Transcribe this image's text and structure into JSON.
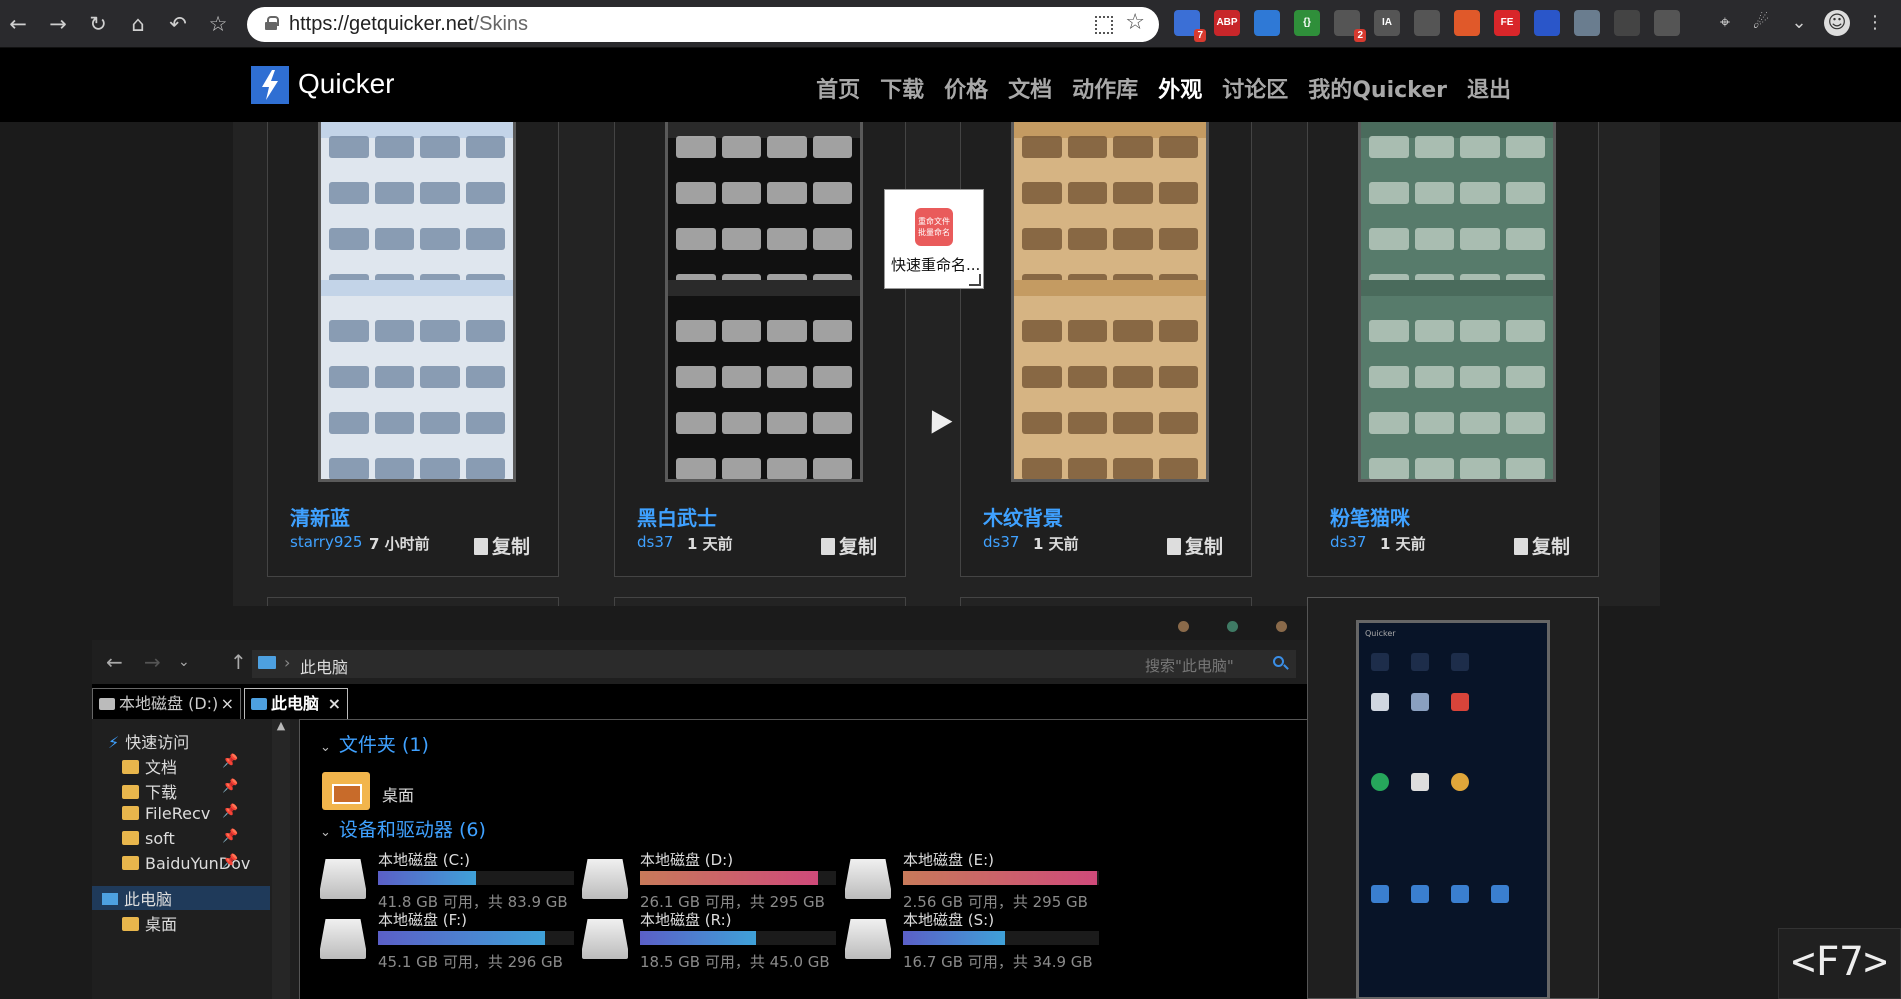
{
  "browser": {
    "url_host": "https://getquicker.net",
    "url_path": "/Skins",
    "extensions": [
      {
        "name": "grid-extension-icon",
        "badge": "7",
        "color": "#3b6fd6"
      },
      {
        "name": "adblock-icon",
        "label": "ABP",
        "color": "#c8262a"
      },
      {
        "name": "shield-check-icon",
        "color": "#2f79d6"
      },
      {
        "name": "json-bracket-icon",
        "label": "{}",
        "color": "#2f8f3a"
      },
      {
        "name": "image-extension-icon",
        "badge": "2",
        "color": "#555555"
      },
      {
        "name": "ia-icon",
        "label": "IA",
        "color": "#555555"
      },
      {
        "name": "cloud-extension-icon",
        "color": "#555555"
      },
      {
        "name": "notes-extension-icon",
        "color": "#e0592a"
      },
      {
        "name": "fe-extension-icon",
        "label": "FE",
        "color": "#d9262a"
      },
      {
        "name": "diamond-extension-icon",
        "color": "#2a56c9"
      },
      {
        "name": "page-extension-icon",
        "color": "#6a7d8f"
      },
      {
        "name": "screen-extension-icon",
        "color": "#444444"
      },
      {
        "name": "pocket-icon",
        "color": "#555555"
      }
    ]
  },
  "site": {
    "logo_text": "Quicker",
    "nav": [
      "首页",
      "下载",
      "价格",
      "文档",
      "动作库",
      "外观",
      "讨论区",
      "我的Quicker",
      "退出"
    ],
    "active_nav": "外观"
  },
  "skins": [
    {
      "title": "清新蓝",
      "author": "starry925",
      "time": "7 小时前",
      "copy": "复制",
      "bg": "#dfe6ee",
      "bar": "#c3d4e8",
      "cell": "#7a8ea8"
    },
    {
      "title": "黑白武士",
      "author": "ds37",
      "time": "1 天前",
      "copy": "复制",
      "bg": "#111111",
      "bar": "#2a2a2a",
      "cell": "#bbbbbb"
    },
    {
      "title": "木纹背景",
      "author": "ds37",
      "time": "1 天前",
      "copy": "复制",
      "bg": "#d6b483",
      "bar": "#c49b62",
      "cell": "#7a5a3a"
    },
    {
      "title": "粉笔猫咪",
      "author": "ds37",
      "time": "1 天前",
      "copy": "复制",
      "bg": "#577b6b",
      "bar": "#4a6b5c",
      "cell": "#b7c9bd"
    }
  ],
  "popup": {
    "caption": "快速重命名...",
    "icon_text": "重命文件 批量命名"
  },
  "dots": [
    "#8a6a4a",
    "#3f7a64",
    "#8a6a4a"
  ],
  "explorer": {
    "path": "此电脑",
    "search_placeholder": "搜索\"此电脑\"",
    "tabs": [
      {
        "label": "本地磁盘 (D:)",
        "active": false
      },
      {
        "label": "此电脑",
        "active": true
      }
    ],
    "sidebar": [
      {
        "label": "快速访问",
        "type": "quick"
      },
      {
        "label": "文档",
        "type": "folder",
        "pinned": true
      },
      {
        "label": "下载",
        "type": "folder",
        "pinned": true
      },
      {
        "label": "FileRecv",
        "type": "folder",
        "pinned": true
      },
      {
        "label": "soft",
        "type": "folder",
        "pinned": true
      },
      {
        "label": "BaiduYunDov",
        "type": "folder",
        "pinned": true
      },
      {
        "label": "此电脑",
        "type": "pc",
        "selected": true
      },
      {
        "label": "桌面",
        "type": "folder"
      }
    ],
    "folders_header": "文件夹 (1)",
    "folders": [
      "桌面"
    ],
    "drives_header": "设备和驱动器 (6)",
    "drives": [
      {
        "name": "本地磁盘 (C:)",
        "info": "41.8 GB 可用，共 83.9 GB",
        "used": 0.5,
        "color": "#4a78c9"
      },
      {
        "name": "本地磁盘 (D:)",
        "info": "26.1 GB 可用，共 295 GB",
        "used": 0.91,
        "color": "#c95a6a"
      },
      {
        "name": "本地磁盘 (E:)",
        "info": "2.56 GB 可用，共 295 GB",
        "used": 0.99,
        "color": "#c95a6a"
      },
      {
        "name": "本地磁盘 (F:)",
        "info": "45.1 GB 可用，共 296 GB",
        "used": 0.85,
        "color": "#4a78c9"
      },
      {
        "name": "本地磁盘 (R:)",
        "info": "18.5 GB 可用，共 45.0 GB",
        "used": 0.59,
        "color": "#4a78c9"
      },
      {
        "name": "本地磁盘 (S:)",
        "info": "16.7 GB 可用，共 34.9 GB",
        "used": 0.52,
        "color": "#4a78c9"
      }
    ]
  },
  "key_overlay": "<F7>"
}
